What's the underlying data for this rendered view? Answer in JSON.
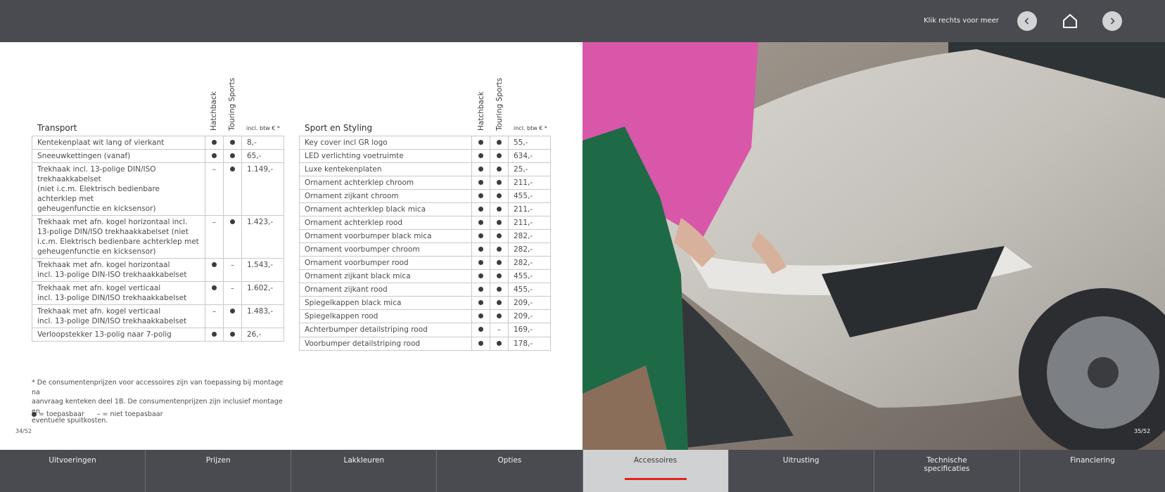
{
  "header": {
    "hint": "Klik rechts voor  meer"
  },
  "transport": {
    "title": "Transport",
    "col1": "Hatchback",
    "col2": "Touring Sports",
    "col3": "incl. btw € *",
    "rows": [
      {
        "name": "Kentekenplaat wit lang of vierkant",
        "h": "dot",
        "t": "dot",
        "price": "8,-"
      },
      {
        "name": "Sneeuwkettingen (vanaf)",
        "h": "dot",
        "t": "dot",
        "price": "65,-"
      },
      {
        "name": "Trekhaak incl. 13-polige DIN/ISO\ntrekhaakkabelset\n(niet i.c.m. Elektrisch bedienbare achterklep met\ngeheugenfunctie en kicksensor)",
        "h": "dash",
        "t": "dot",
        "price": "1.149,-"
      },
      {
        "name": "Trekhaak met afn. kogel horizontaal incl.\n13-polige DIN/ISO trekhaakkabelset (niet\ni.c.m. Elektrisch bedienbare achterklep met\ngeheugenfunctie en kicksensor)",
        "h": "dash",
        "t": "dot",
        "price": "1.423,-"
      },
      {
        "name": "Trekhaak met afn. kogel horizontaal\nincl. 13-polige DIN-ISO trekhaakkabelset",
        "h": "dot",
        "t": "dash",
        "price": "1.543,-"
      },
      {
        "name": "Trekhaak met afn. kogel verticaal\nincl. 13-polige DIN/ISO trekhaakkabelset",
        "h": "dot",
        "t": "dash",
        "price": "1.602,-"
      },
      {
        "name": "Trekhaak met afn. kogel verticaal\nincl. 13-polige DIN/ISO trekhaakkabelset",
        "h": "dash",
        "t": "dot",
        "price": "1.483,-"
      },
      {
        "name": "Verloopstekker 13-polig naar 7-polig",
        "h": "dot",
        "t": "dot",
        "price": "26,-"
      }
    ]
  },
  "sport": {
    "title": "Sport en Styling",
    "col1": "Hatchback",
    "col2": "Touring Sports",
    "col3": "incl. btw € *",
    "rows": [
      {
        "name": "Key cover incl GR logo",
        "h": "dot",
        "t": "dot",
        "price": "55,-"
      },
      {
        "name": "LED verlichting voetruimte",
        "h": "dot",
        "t": "dot",
        "price": "634,-"
      },
      {
        "name": "Luxe kentekenplaten",
        "h": "dot",
        "t": "dot",
        "price": "25,-"
      },
      {
        "name": "Ornament achterklep chroom",
        "h": "dot",
        "t": "dot",
        "price": "211,-"
      },
      {
        "name": "Ornament zijkant chroom",
        "h": "dot",
        "t": "dot",
        "price": "455,-"
      },
      {
        "name": "Ornament achterklep black mica",
        "h": "dot",
        "t": "dot",
        "price": "211,-"
      },
      {
        "name": "Ornament achterklep rood",
        "h": "dot",
        "t": "dot",
        "price": "211,-"
      },
      {
        "name": "Ornament voorbumper black mica",
        "h": "dot",
        "t": "dot",
        "price": "282,-"
      },
      {
        "name": "Ornament voorbumper chroom",
        "h": "dot",
        "t": "dot",
        "price": "282,-"
      },
      {
        "name": "Ornament voorbumper rood",
        "h": "dot",
        "t": "dot",
        "price": "282,-"
      },
      {
        "name": "Ornament zijkant black mica",
        "h": "dot",
        "t": "dot",
        "price": "455,-"
      },
      {
        "name": "Ornament zijkant rood",
        "h": "dot",
        "t": "dot",
        "price": "455,-"
      },
      {
        "name": "Spiegelkappen black mica",
        "h": "dot",
        "t": "dot",
        "price": "209,-"
      },
      {
        "name": "Spiegelkappen rood",
        "h": "dot",
        "t": "dot",
        "price": "209,-"
      },
      {
        "name": "Achterbumper detailstriping rood",
        "h": "dot",
        "t": "dash",
        "price": "169,-"
      },
      {
        "name": "Voorbumper detailstriping rood",
        "h": "dot",
        "t": "dot",
        "price": "178,-"
      }
    ]
  },
  "footnote": "* De consumentenprijzen voor accessoires zijn van toepassing bij montage na\n   aanvraag kenteken deel 1B. De consumentenprijzen zijn inclusief montage en\n   eventuele spuitkosten.",
  "legend": {
    "applicable": "= toepasbaar",
    "not_applicable": "– = niet toepasbaar"
  },
  "pages": {
    "left": "34/52",
    "right": "35/52"
  },
  "nav": {
    "tabs": [
      {
        "label": "Uitvoeringen",
        "active": false
      },
      {
        "label": "Prijzen",
        "active": false
      },
      {
        "label": "Lakkleuren",
        "active": false
      },
      {
        "label": "Opties",
        "active": false
      },
      {
        "label": "Accessoires",
        "active": true
      },
      {
        "label": "Uitrusting",
        "active": false
      },
      {
        "label": "Technische\nspecificaties",
        "active": false
      },
      {
        "label": "Financiering",
        "active": false
      }
    ]
  },
  "colors": {
    "bar": "#4a4b50",
    "active_tab": "#d0d1d3",
    "accent": "#e2231a"
  }
}
